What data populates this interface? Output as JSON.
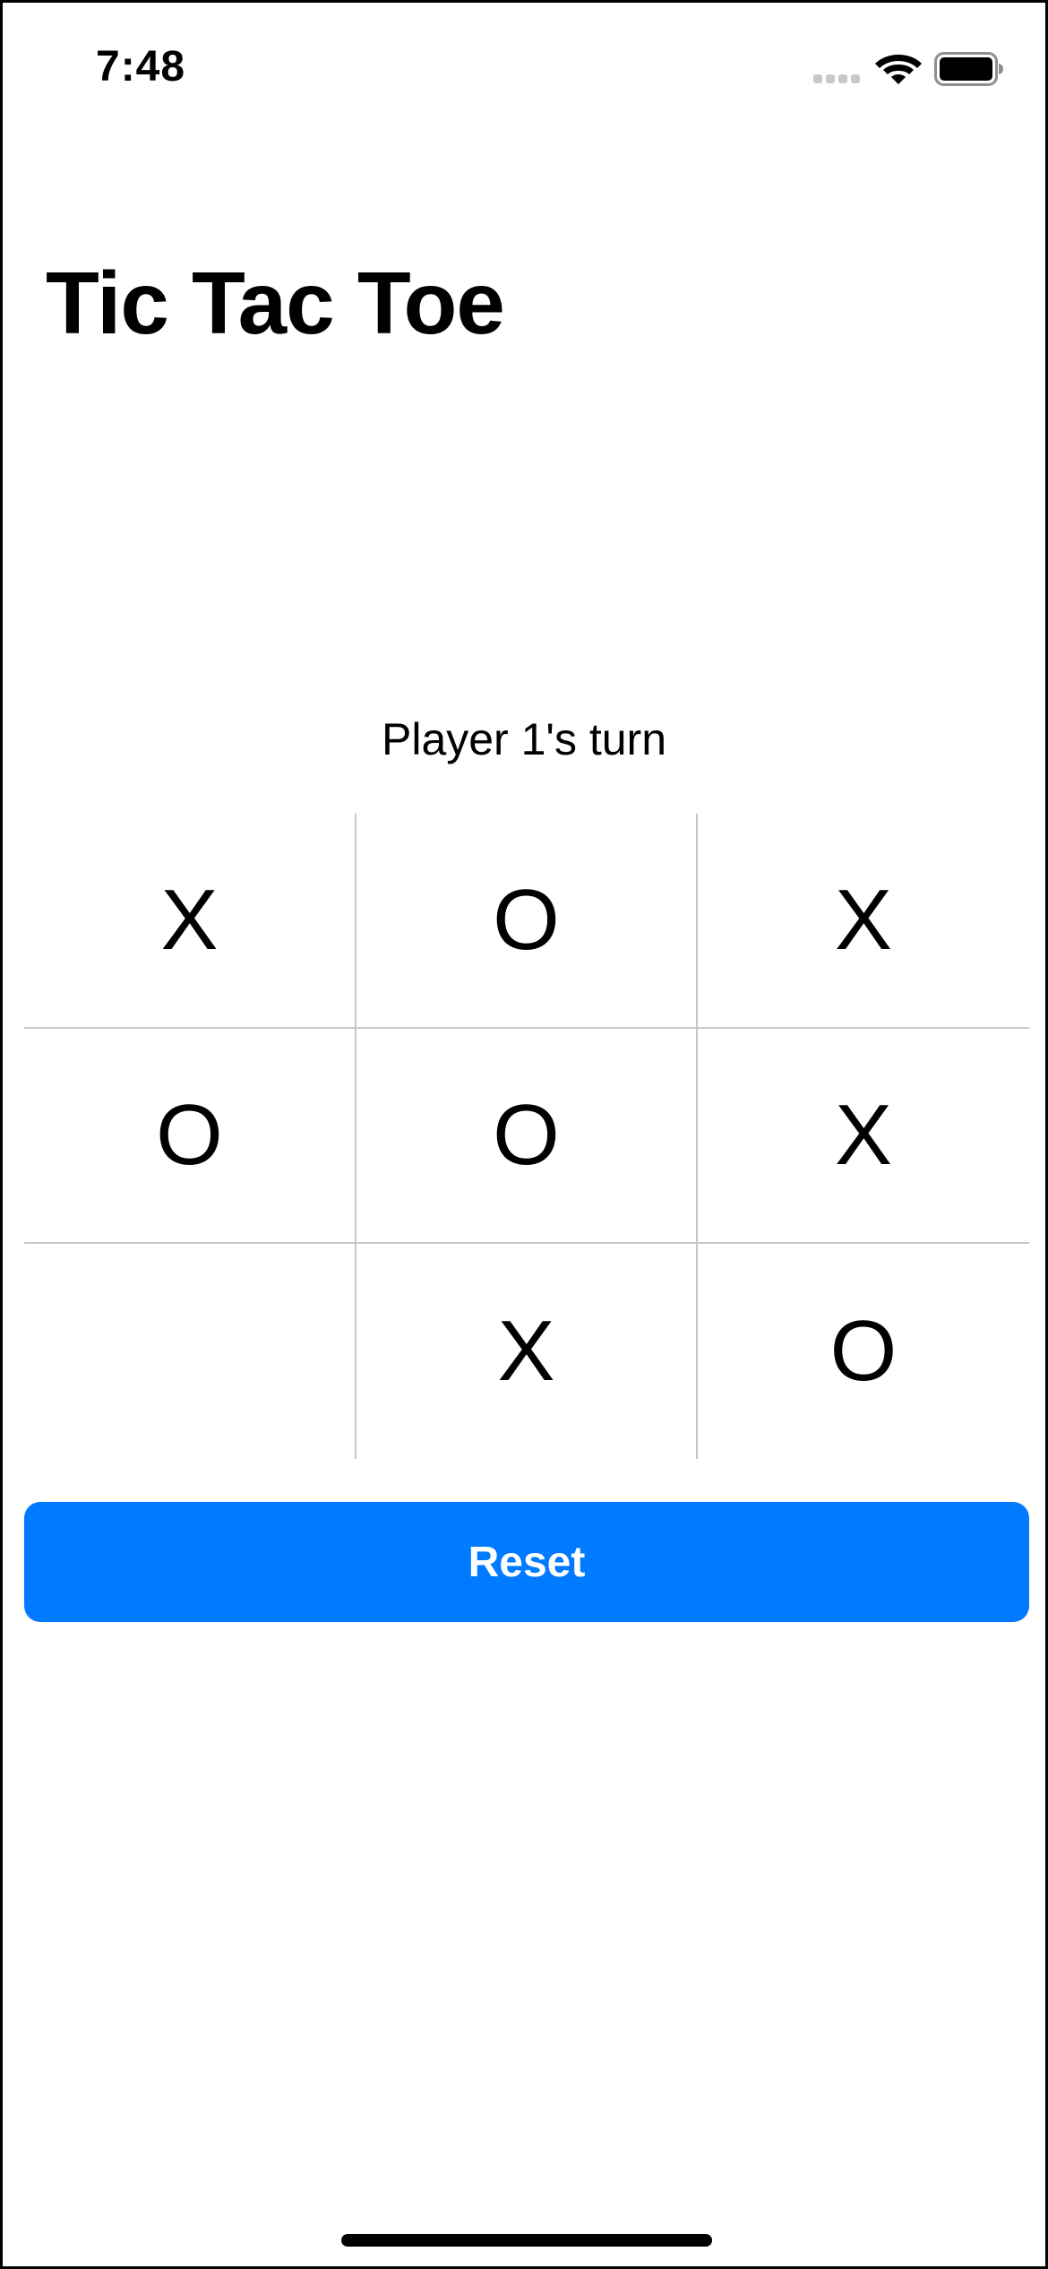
{
  "status_bar": {
    "time": "7:48",
    "icons": {
      "signal": "signal-dots-icon",
      "wifi": "wifi-icon",
      "battery": "battery-full-icon"
    }
  },
  "header": {
    "title": "Tic Tac Toe"
  },
  "game": {
    "turn_text": "Player 1's turn",
    "board": [
      [
        "X",
        "O",
        "X"
      ],
      [
        "O",
        "O",
        "X"
      ],
      [
        "",
        "X",
        "O"
      ]
    ]
  },
  "actions": {
    "reset_label": "Reset"
  },
  "colors": {
    "accent": "#007aff",
    "grid_line": "#c6c6c8",
    "text": "#000000",
    "background": "#ffffff"
  }
}
